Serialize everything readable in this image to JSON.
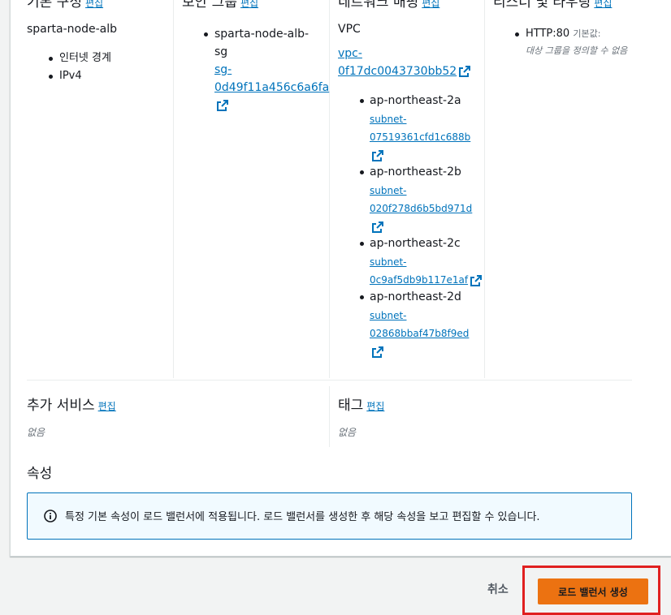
{
  "basic": {
    "title": "기본 구성",
    "edit": "편집",
    "name": "sparta-node-alb",
    "items": [
      "인터넷 경계",
      "IPv4"
    ]
  },
  "security": {
    "title": "보안 그룹",
    "edit": "편집",
    "name_line1": "sparta-node-alb-",
    "name_line2": "sg",
    "link_line1": "sg-",
    "link_line2": "0d49f11a456c6a6fa"
  },
  "network": {
    "title": "네트워크 매핑",
    "edit": "편집",
    "vpc_label": "VPC",
    "vpc_line1": "vpc-",
    "vpc_line2": "0f17dc0043730bb52",
    "subnets": [
      {
        "az": "ap-northeast-2a",
        "line1": "subnet-",
        "line2": "07519361cfd1c688b"
      },
      {
        "az": "ap-northeast-2b",
        "line1": "subnet-",
        "line2": "020f278d6b5bd971d"
      },
      {
        "az": "ap-northeast-2c",
        "line1": "subnet-",
        "line2": "0c9af5db9b117e1af"
      },
      {
        "az": "ap-northeast-2d",
        "line1": "subnet-",
        "line2": "02868bbaf47b8f9ed"
      }
    ]
  },
  "listener": {
    "title": "리스너 및 라우팅",
    "edit": "편집",
    "item": "HTTP:80",
    "default_label": "기본값:",
    "default_desc": "대상 그룹을 정의할 수 없음"
  },
  "addons": {
    "title": "추가 서비스",
    "edit": "편집",
    "value": "없음"
  },
  "tags": {
    "title": "태그",
    "edit": "편집",
    "value": "없음"
  },
  "attributes": {
    "title": "속성",
    "info": "특정 기본 속성이 로드 밸런서에 적용됩니다. 로드 밸런서를 생성한 후 해당 속성을 보고 편집할 수 있습니다."
  },
  "footer": {
    "cancel": "취소",
    "create": "로드 밸런서 생성"
  },
  "colors": {
    "accent": "#ec7211",
    "link": "#0073bb",
    "highlight": "#e02020"
  }
}
